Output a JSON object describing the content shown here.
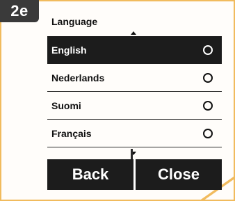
{
  "step_badge": "2e",
  "screen": {
    "heading": "Language",
    "languages": [
      {
        "label": "English",
        "selected": true
      },
      {
        "label": "Nederlands",
        "selected": false
      },
      {
        "label": "Suomi",
        "selected": false
      },
      {
        "label": "Français",
        "selected": false
      }
    ]
  },
  "buttons": {
    "back_label": "Back",
    "close_label": "Close"
  },
  "icons": {
    "scroll_up": "triangle-up-icon",
    "scroll_down": "triangle-down-icon",
    "radio": "radio-circle-icon"
  },
  "colors": {
    "frame_border": "#f1bb5d",
    "badge_bg": "#3a3a3a",
    "selected_bg": "#1c1c1c",
    "button_bg": "#1c1c1c"
  }
}
